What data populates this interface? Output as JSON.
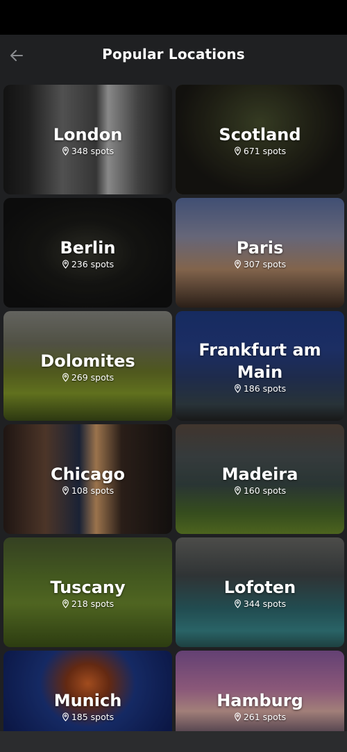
{
  "header": {
    "title": "Popular Locations",
    "back_icon": "arrow-left-icon"
  },
  "locations": [
    {
      "name": "London",
      "spots": "348 spots"
    },
    {
      "name": "Scotland",
      "spots": "671 spots"
    },
    {
      "name": "Berlin",
      "spots": "236 spots"
    },
    {
      "name": "Paris",
      "spots": "307 spots"
    },
    {
      "name": "Dolomites",
      "spots": "269 spots"
    },
    {
      "name": "Frankfurt am Main",
      "spots": "186 spots"
    },
    {
      "name": "Chicago",
      "spots": "108 spots"
    },
    {
      "name": "Madeira",
      "spots": "160 spots"
    },
    {
      "name": "Tuscany",
      "spots": "218 spots"
    },
    {
      "name": "Lofoten",
      "spots": "344 spots"
    },
    {
      "name": "Munich",
      "spots": "185 spots"
    },
    {
      "name": "Hamburg",
      "spots": "261 spots"
    }
  ],
  "colors": {
    "background": "#1f2022",
    "status_bar": "#000000",
    "text": "#ffffff"
  }
}
